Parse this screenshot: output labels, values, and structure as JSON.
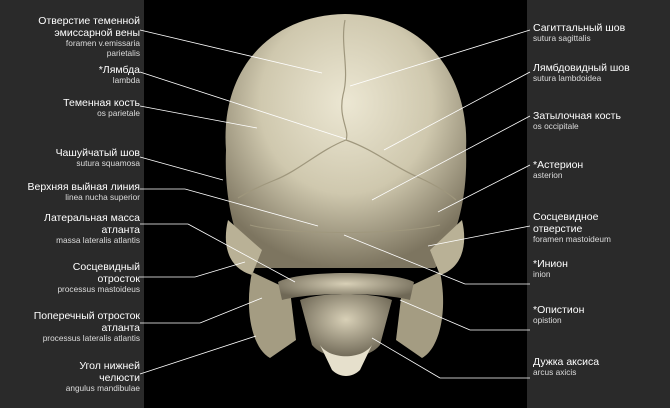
{
  "left_labels": [
    {
      "ru": "Отверстие теменной",
      "ru2": "эмиссарной вены",
      "la": "foramen v.emissaria",
      "la2": "parietalis"
    },
    {
      "ru": "*Лямбда",
      "la": "lambda"
    },
    {
      "ru": "Теменная кость",
      "la": "os parietale"
    },
    {
      "ru": "Чашуйчатый шов",
      "la": "sutura squamosa"
    },
    {
      "ru": "Верхняя выйная линия",
      "la": "linea nucha superior"
    },
    {
      "ru": "Латеральная масса",
      "ru2": "атланта",
      "la": "massa lateralis atlantis"
    },
    {
      "ru": "Сосцевидный",
      "ru2": "отросток",
      "la": "processus mastoideus"
    },
    {
      "ru": "Поперечный отросток",
      "ru2": "атланта",
      "la": "processus lateralis atlantis"
    },
    {
      "ru": "Угол нижней",
      "ru2": "челюсти",
      "la": "angulus mandibulae"
    }
  ],
  "right_labels": [
    {
      "ru": "Сагиттальный шов",
      "la": "sutura sagittalis"
    },
    {
      "ru": "Лямбдовидный шов",
      "la": "sutura lambdoidea"
    },
    {
      "ru": "Затылочная кость",
      "la": "os occipitale"
    },
    {
      "ru": "*Астерион",
      "la": "asterion"
    },
    {
      "ru": "Сосцевидное",
      "ru2": "отверстие",
      "la": "foramen mastoideum"
    },
    {
      "ru": "*Инион",
      "la": "inion"
    },
    {
      "ru": "*Опистион",
      "la": "opistion"
    },
    {
      "ru": "Дужка аксиса",
      "la": "arcus axicis"
    }
  ],
  "colors": {
    "panel": "#2a2a2a",
    "bone": "#d9d3bd",
    "leader": "#ffffff"
  }
}
